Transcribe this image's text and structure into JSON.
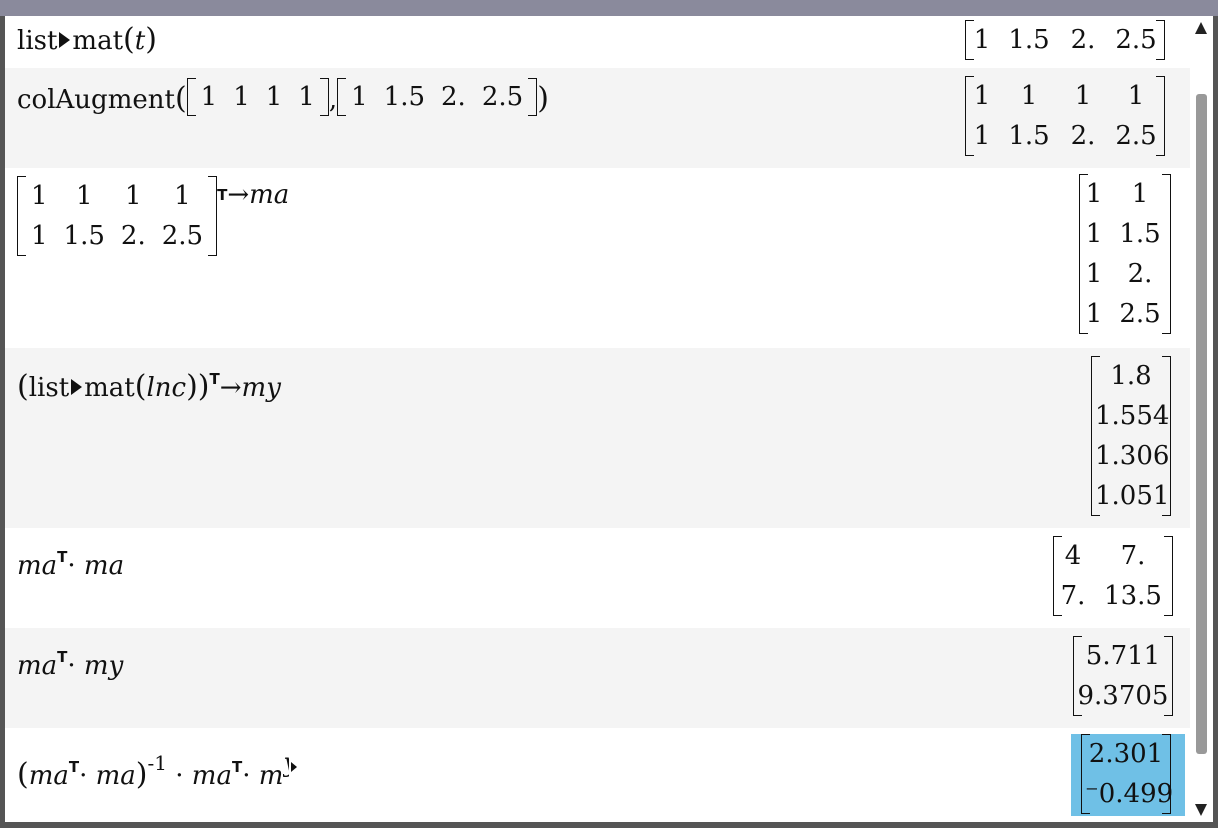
{
  "entries": [
    {
      "input": {
        "fn": "list",
        "fn2": "mat",
        "arg": "t"
      },
      "result": [
        [
          "1",
          "1.5",
          "2.",
          "2.5"
        ]
      ]
    },
    {
      "input": {
        "fn": "colAugment",
        "m1": [
          [
            "1",
            "1",
            "1",
            "1"
          ]
        ],
        "m2": [
          [
            "1",
            "1.5",
            "2.",
            "2.5"
          ]
        ]
      },
      "result": [
        [
          "1",
          "1",
          "1",
          "1"
        ],
        [
          "1",
          "1.5",
          "2.",
          "2.5"
        ]
      ]
    },
    {
      "input": {
        "matrix": [
          [
            "1",
            "1",
            "1",
            "1"
          ],
          [
            "1",
            "1.5",
            "2.",
            "2.5"
          ]
        ],
        "sup": "T",
        "arrow": "→",
        "store": "ma"
      },
      "result": [
        [
          "1",
          "1"
        ],
        [
          "1",
          "1.5"
        ],
        [
          "1",
          "2."
        ],
        [
          "1",
          "2.5"
        ]
      ]
    },
    {
      "input": {
        "fn": "list",
        "fn2": "mat",
        "arg": "lnc",
        "sup": "T",
        "arrow": "→",
        "store": "my"
      },
      "result": [
        [
          "1.8"
        ],
        [
          "1.554"
        ],
        [
          "1.306"
        ],
        [
          "1.051"
        ]
      ]
    },
    {
      "input": {
        "a": "ma",
        "sup": "T",
        "dot": "·",
        "b": "ma"
      },
      "result": [
        [
          "4",
          "7."
        ],
        [
          "7.",
          "13.5"
        ]
      ]
    },
    {
      "input": {
        "a": "ma",
        "sup": "T",
        "dot": "·",
        "b": "my"
      },
      "result": [
        [
          "5.711"
        ],
        [
          "9.3705"
        ]
      ]
    },
    {
      "input": {
        "a": "ma",
        "sup": "T",
        "dot": "·",
        "b": "ma",
        "exp": "-1",
        "c": "ma",
        "d": "m",
        "dpart": "y"
      },
      "result": [
        [
          "2.301"
        ],
        [
          "⁻0.499"
        ]
      ]
    }
  ],
  "colors": {
    "highlight": "#6fc0e6",
    "alt_row": "#f4f4f4",
    "frame": "#555555"
  }
}
